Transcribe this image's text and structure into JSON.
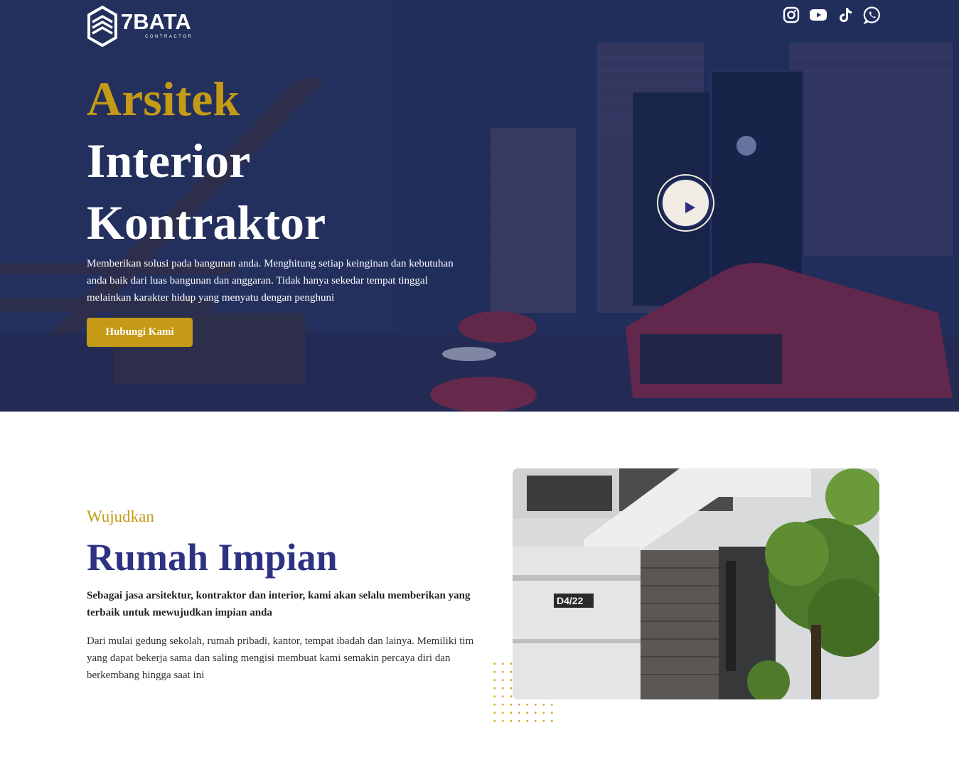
{
  "brand": {
    "logo_word": "7BATA",
    "logo_sub": "CONTRACTOR"
  },
  "socials": {
    "icons": [
      "instagram-icon",
      "youtube-icon",
      "tiktok-icon",
      "whatsapp-icon"
    ]
  },
  "hero": {
    "title_line1": "Arsitek",
    "title_line2": "Interior",
    "title_line3": "Kontraktor",
    "description": "Memberikan solusi pada bangunan anda. Menghitung setiap keinginan dan kebutuhan anda baik dari luas bangunan dan anggaran. Tidak hanya sekedar tempat tinggal melainkan karakter hidup yang menyatu dengan penghuni",
    "cta_label": "Hubungi Kami",
    "play_icon": "play-icon"
  },
  "about": {
    "kicker": "Wujudkan",
    "title": "Rumah Impian",
    "lead": "Sebagai jasa arsitektur, kontraktor dan interior, kami akan selalu memberikan yang terbaik untuk mewujudkan impian anda",
    "body": "Dari mulai gedung sekolah, rumah pribadi, kantor, tempat ibadah dan lainya. Memiliki tim yang dapat bekerja sama dan saling mengisi membuat kami semakin percaya diri dan berkembang hingga saat ini",
    "house_number": "D4/22"
  },
  "colors": {
    "gold": "#c49a16",
    "navy": "#2e3283",
    "hero_overlay": "#1f2c58"
  }
}
